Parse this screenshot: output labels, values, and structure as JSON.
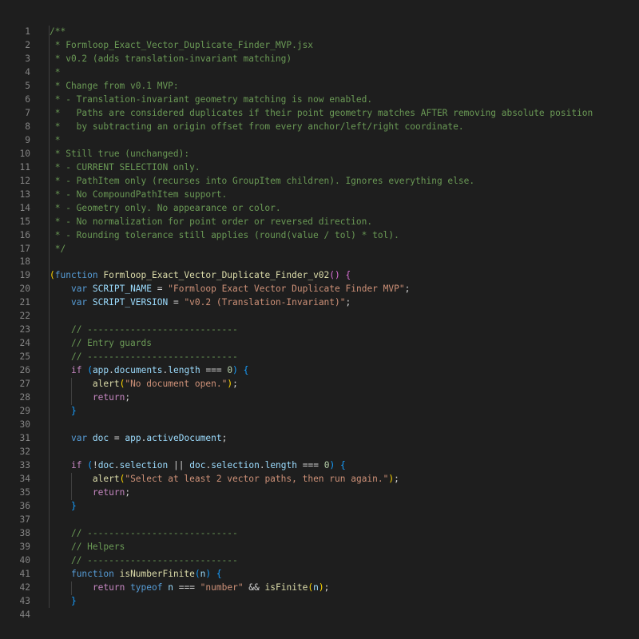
{
  "editor": {
    "lines": [
      {
        "n": "1",
        "tokens": [
          {
            "c": "com",
            "t": "/**"
          }
        ]
      },
      {
        "n": "2",
        "tokens": [
          {
            "c": "com",
            "t": " * Formloop_Exact_Vector_Duplicate_Finder_MVP.jsx"
          }
        ]
      },
      {
        "n": "3",
        "tokens": [
          {
            "c": "com",
            "t": " * v0.2 (adds translation-invariant matching)"
          }
        ]
      },
      {
        "n": "4",
        "tokens": [
          {
            "c": "com",
            "t": " *"
          }
        ]
      },
      {
        "n": "5",
        "tokens": [
          {
            "c": "com",
            "t": " * Change from v0.1 MVP:"
          }
        ]
      },
      {
        "n": "6",
        "tokens": [
          {
            "c": "com",
            "t": " * - Translation-invariant geometry matching is now enabled."
          }
        ]
      },
      {
        "n": "7",
        "tokens": [
          {
            "c": "com",
            "t": " *   Paths are considered duplicates if their point geometry matches AFTER removing absolute position"
          }
        ]
      },
      {
        "n": "8",
        "tokens": [
          {
            "c": "com",
            "t": " *   by subtracting an origin offset from every anchor/left/right coordinate."
          }
        ]
      },
      {
        "n": "9",
        "tokens": [
          {
            "c": "com",
            "t": " *"
          }
        ]
      },
      {
        "n": "10",
        "tokens": [
          {
            "c": "com",
            "t": " * Still true (unchanged):"
          }
        ]
      },
      {
        "n": "11",
        "tokens": [
          {
            "c": "com",
            "t": " * - CURRENT SELECTION only."
          }
        ]
      },
      {
        "n": "12",
        "tokens": [
          {
            "c": "com",
            "t": " * - PathItem only (recurses into GroupItem children). Ignores everything else."
          }
        ]
      },
      {
        "n": "13",
        "tokens": [
          {
            "c": "com",
            "t": " * - No CompoundPathItem support."
          }
        ]
      },
      {
        "n": "14",
        "tokens": [
          {
            "c": "com",
            "t": " * - Geometry only. No appearance or color."
          }
        ]
      },
      {
        "n": "15",
        "tokens": [
          {
            "c": "com",
            "t": " * - No normalization for point order or reversed direction."
          }
        ]
      },
      {
        "n": "16",
        "tokens": [
          {
            "c": "com",
            "t": " * - Rounding tolerance still applies (round(value / tol) * tol)."
          }
        ]
      },
      {
        "n": "17",
        "tokens": [
          {
            "c": "com",
            "t": " */"
          }
        ]
      },
      {
        "n": "18",
        "tokens": []
      },
      {
        "n": "19",
        "tokens": [
          {
            "c": "p1",
            "t": "("
          },
          {
            "c": "kw",
            "t": "function"
          },
          {
            "c": "op",
            "t": " "
          },
          {
            "c": "fn",
            "t": "Formloop_Exact_Vector_Duplicate_Finder_v02"
          },
          {
            "c": "p2",
            "t": "()"
          },
          {
            "c": "op",
            "t": " "
          },
          {
            "c": "p2",
            "t": "{"
          }
        ]
      },
      {
        "n": "20",
        "tokens": [
          {
            "c": "op",
            "t": "    "
          },
          {
            "c": "kw",
            "t": "var"
          },
          {
            "c": "op",
            "t": " "
          },
          {
            "c": "var",
            "t": "SCRIPT_NAME"
          },
          {
            "c": "op",
            "t": " = "
          },
          {
            "c": "str",
            "t": "\"Formloop Exact Vector Duplicate Finder MVP\""
          },
          {
            "c": "op",
            "t": ";"
          }
        ]
      },
      {
        "n": "21",
        "tokens": [
          {
            "c": "op",
            "t": "    "
          },
          {
            "c": "kw",
            "t": "var"
          },
          {
            "c": "op",
            "t": " "
          },
          {
            "c": "var",
            "t": "SCRIPT_VERSION"
          },
          {
            "c": "op",
            "t": " = "
          },
          {
            "c": "str",
            "t": "\"v0.2 (Translation-Invariant)\""
          },
          {
            "c": "op",
            "t": ";"
          }
        ]
      },
      {
        "n": "22",
        "tokens": []
      },
      {
        "n": "23",
        "tokens": [
          {
            "c": "op",
            "t": "    "
          },
          {
            "c": "com",
            "t": "// ----------------------------"
          }
        ]
      },
      {
        "n": "24",
        "tokens": [
          {
            "c": "op",
            "t": "    "
          },
          {
            "c": "com",
            "t": "// Entry guards"
          }
        ]
      },
      {
        "n": "25",
        "tokens": [
          {
            "c": "op",
            "t": "    "
          },
          {
            "c": "com",
            "t": "// ----------------------------"
          }
        ]
      },
      {
        "n": "26",
        "tokens": [
          {
            "c": "op",
            "t": "    "
          },
          {
            "c": "ctl",
            "t": "if"
          },
          {
            "c": "op",
            "t": " "
          },
          {
            "c": "p3",
            "t": "("
          },
          {
            "c": "var",
            "t": "app"
          },
          {
            "c": "op",
            "t": "."
          },
          {
            "c": "var",
            "t": "documents"
          },
          {
            "c": "op",
            "t": "."
          },
          {
            "c": "var",
            "t": "length"
          },
          {
            "c": "op",
            "t": " === "
          },
          {
            "c": "num",
            "t": "0"
          },
          {
            "c": "p3",
            "t": ")"
          },
          {
            "c": "op",
            "t": " "
          },
          {
            "c": "p3",
            "t": "{"
          }
        ]
      },
      {
        "n": "27",
        "tokens": [
          {
            "c": "op",
            "t": "        "
          },
          {
            "c": "fn",
            "t": "alert"
          },
          {
            "c": "p1",
            "t": "("
          },
          {
            "c": "str",
            "t": "\"No document open.\""
          },
          {
            "c": "p1",
            "t": ")"
          },
          {
            "c": "op",
            "t": ";"
          }
        ]
      },
      {
        "n": "28",
        "tokens": [
          {
            "c": "op",
            "t": "        "
          },
          {
            "c": "ctl",
            "t": "return"
          },
          {
            "c": "op",
            "t": ";"
          }
        ]
      },
      {
        "n": "29",
        "tokens": [
          {
            "c": "op",
            "t": "    "
          },
          {
            "c": "p3",
            "t": "}"
          }
        ]
      },
      {
        "n": "30",
        "tokens": []
      },
      {
        "n": "31",
        "tokens": [
          {
            "c": "op",
            "t": "    "
          },
          {
            "c": "kw",
            "t": "var"
          },
          {
            "c": "op",
            "t": " "
          },
          {
            "c": "var",
            "t": "doc"
          },
          {
            "c": "op",
            "t": " = "
          },
          {
            "c": "var",
            "t": "app"
          },
          {
            "c": "op",
            "t": "."
          },
          {
            "c": "var",
            "t": "activeDocument"
          },
          {
            "c": "op",
            "t": ";"
          }
        ]
      },
      {
        "n": "32",
        "tokens": []
      },
      {
        "n": "33",
        "tokens": [
          {
            "c": "op",
            "t": "    "
          },
          {
            "c": "ctl",
            "t": "if"
          },
          {
            "c": "op",
            "t": " "
          },
          {
            "c": "p3",
            "t": "("
          },
          {
            "c": "op",
            "t": "!"
          },
          {
            "c": "var",
            "t": "doc"
          },
          {
            "c": "op",
            "t": "."
          },
          {
            "c": "var",
            "t": "selection"
          },
          {
            "c": "op",
            "t": " || "
          },
          {
            "c": "var",
            "t": "doc"
          },
          {
            "c": "op",
            "t": "."
          },
          {
            "c": "var",
            "t": "selection"
          },
          {
            "c": "op",
            "t": "."
          },
          {
            "c": "var",
            "t": "length"
          },
          {
            "c": "op",
            "t": " === "
          },
          {
            "c": "num",
            "t": "0"
          },
          {
            "c": "p3",
            "t": ")"
          },
          {
            "c": "op",
            "t": " "
          },
          {
            "c": "p3",
            "t": "{"
          }
        ]
      },
      {
        "n": "34",
        "tokens": [
          {
            "c": "op",
            "t": "        "
          },
          {
            "c": "fn",
            "t": "alert"
          },
          {
            "c": "p1",
            "t": "("
          },
          {
            "c": "str",
            "t": "\"Select at least 2 vector paths, then run again.\""
          },
          {
            "c": "p1",
            "t": ")"
          },
          {
            "c": "op",
            "t": ";"
          }
        ]
      },
      {
        "n": "35",
        "tokens": [
          {
            "c": "op",
            "t": "        "
          },
          {
            "c": "ctl",
            "t": "return"
          },
          {
            "c": "op",
            "t": ";"
          }
        ]
      },
      {
        "n": "36",
        "tokens": [
          {
            "c": "op",
            "t": "    "
          },
          {
            "c": "p3",
            "t": "}"
          }
        ]
      },
      {
        "n": "37",
        "tokens": []
      },
      {
        "n": "38",
        "tokens": [
          {
            "c": "op",
            "t": "    "
          },
          {
            "c": "com",
            "t": "// ----------------------------"
          }
        ]
      },
      {
        "n": "39",
        "tokens": [
          {
            "c": "op",
            "t": "    "
          },
          {
            "c": "com",
            "t": "// Helpers"
          }
        ]
      },
      {
        "n": "40",
        "tokens": [
          {
            "c": "op",
            "t": "    "
          },
          {
            "c": "com",
            "t": "// ----------------------------"
          }
        ]
      },
      {
        "n": "41",
        "tokens": [
          {
            "c": "op",
            "t": "    "
          },
          {
            "c": "kw",
            "t": "function"
          },
          {
            "c": "op",
            "t": " "
          },
          {
            "c": "fn",
            "t": "isNumberFinite"
          },
          {
            "c": "p3",
            "t": "("
          },
          {
            "c": "var",
            "t": "n"
          },
          {
            "c": "p3",
            "t": ")"
          },
          {
            "c": "op",
            "t": " "
          },
          {
            "c": "p3",
            "t": "{"
          }
        ]
      },
      {
        "n": "42",
        "tokens": [
          {
            "c": "op",
            "t": "        "
          },
          {
            "c": "ctl",
            "t": "return"
          },
          {
            "c": "op",
            "t": " "
          },
          {
            "c": "kw",
            "t": "typeof"
          },
          {
            "c": "op",
            "t": " "
          },
          {
            "c": "var",
            "t": "n"
          },
          {
            "c": "op",
            "t": " === "
          },
          {
            "c": "str",
            "t": "\"number\""
          },
          {
            "c": "op",
            "t": " && "
          },
          {
            "c": "fn",
            "t": "isFinite"
          },
          {
            "c": "p1",
            "t": "("
          },
          {
            "c": "var",
            "t": "n"
          },
          {
            "c": "p1",
            "t": ")"
          },
          {
            "c": "op",
            "t": ";"
          }
        ]
      },
      {
        "n": "43",
        "tokens": [
          {
            "c": "op",
            "t": "    "
          },
          {
            "c": "p3",
            "t": "}"
          }
        ]
      },
      {
        "n": "44",
        "tokens": []
      }
    ]
  },
  "colors": {
    "background": "#1e1e1e",
    "line_number": "#858585",
    "comment": "#6a9955",
    "keyword": "#569cd6",
    "control": "#c586c0",
    "function": "#dcdcaa",
    "variable": "#9cdcfe",
    "string": "#ce9178",
    "number": "#b5cea8"
  }
}
